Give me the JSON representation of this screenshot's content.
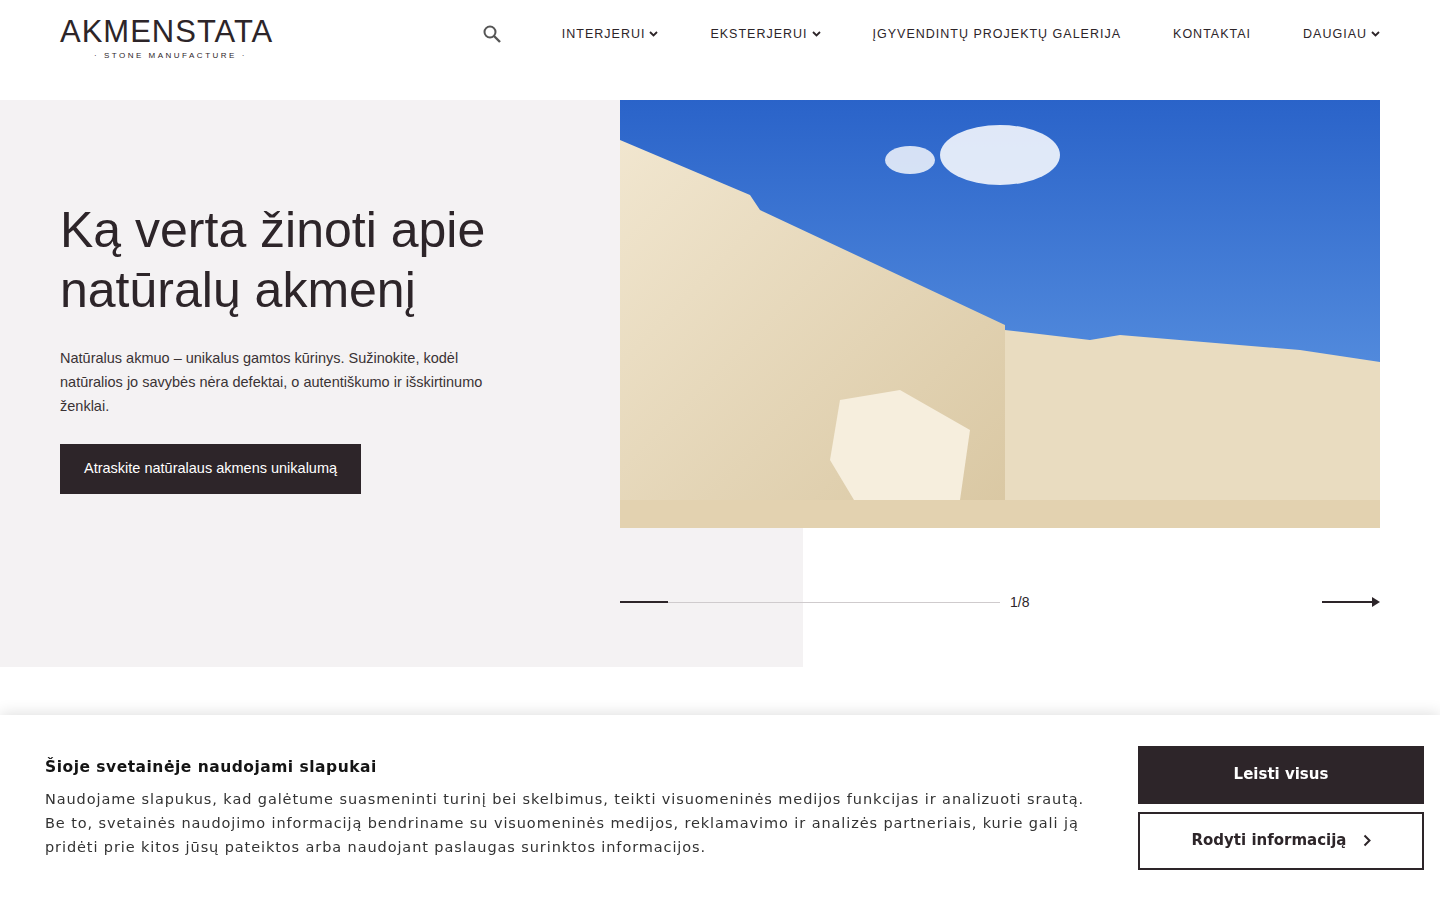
{
  "logo": {
    "name": "AKMENSTATA",
    "tagline": "· STONE MANUFACTURE ·"
  },
  "nav": [
    {
      "label": "INTERJERUI",
      "dropdown": true
    },
    {
      "label": "EKSTERJERUI",
      "dropdown": true
    },
    {
      "label": "ĮGYVENDINTŲ PROJEKTŲ GALERIJA",
      "dropdown": false
    },
    {
      "label": "KONTAKTAI",
      "dropdown": false
    },
    {
      "label": "DAUGIAU",
      "dropdown": true
    }
  ],
  "hero": {
    "title": "Ką verta žinoti apie natūralų akmenį",
    "text": "Natūralus akmuo – unikalus gamtos kūrinys. Sužinokite, kodėl natūralios jo savybės nėra defektai, o autentiškumo ir išskirtinumo ženklai.",
    "button": "Atraskite natūralaus akmens unikalumą",
    "counter": "1/8",
    "level": 0.125
  },
  "cookie": {
    "title": "Šioje svetainėje naudojami slapukai",
    "text": "Naudojame slapukus, kad galėtume suasmeninti turinį bei skelbimus, teikti visuomeninės medijos funkcijas ir analizuoti srautą. Be to, svetainės naudojimo informaciją bendriname su visuomeninės medijos, reklamavimo ir analizės partneriais, kurie gali ją pridėti prie kitos jūsų pateiktos arba naudojant paslaugas surinktos informacijos.",
    "buttons": [
      "Leisti visus",
      "Rodyti informaciją"
    ]
  }
}
